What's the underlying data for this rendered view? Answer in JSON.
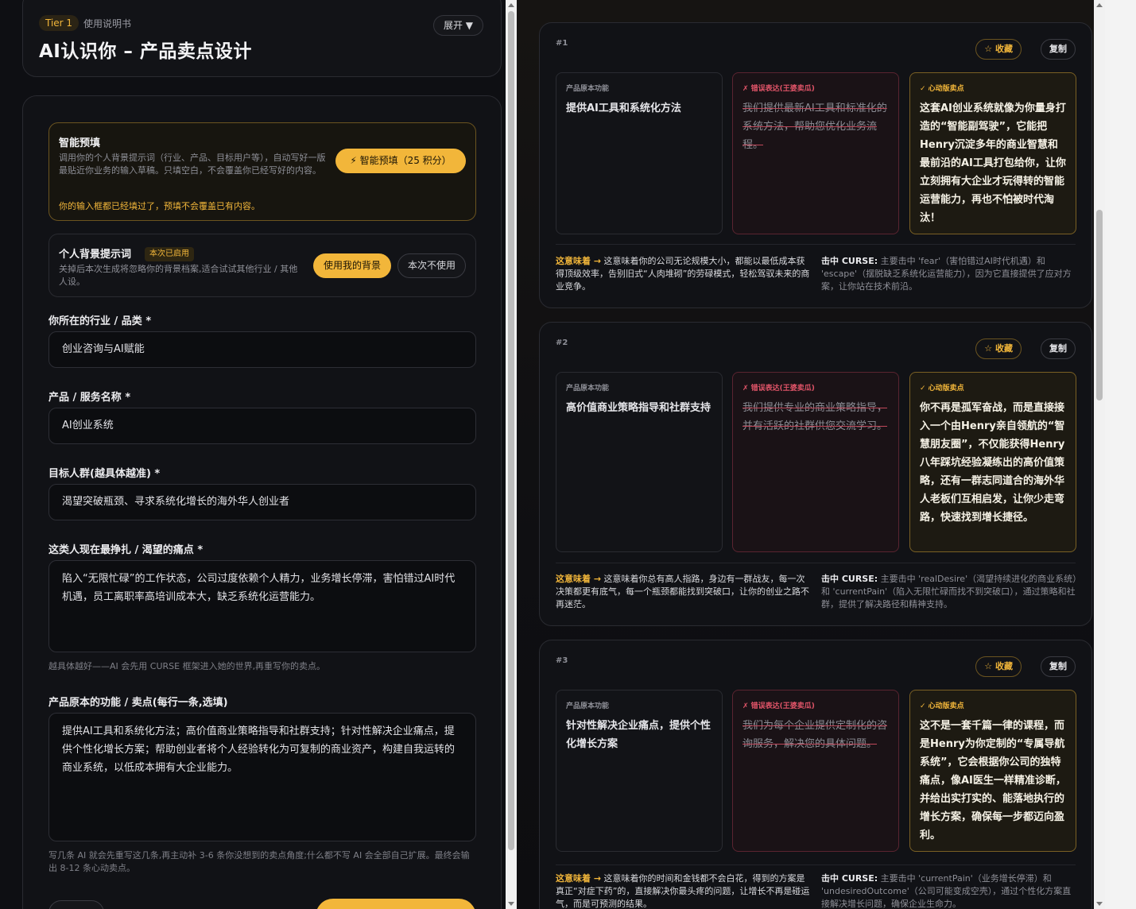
{
  "header": {
    "tier": "Tier 1",
    "subtitle": "使用说明书",
    "title": "AI认识你 – 产品卖点设计",
    "expand": "展开 ▼"
  },
  "smart": {
    "title": "智能预填",
    "desc": "调用你的个人背景提示词（行业、产品、目标用户等），自动写好一版最贴近你业务的输入草稿。只填空白，不会覆盖你已经写好的内容。",
    "warn": "你的输入框都已经填过了，预填不会覆盖已有内容。",
    "button": "⚡ 智能预填（25 积分）"
  },
  "background": {
    "title": "个人背景提示词",
    "badge": "本次已启用",
    "desc": "关掉后本次生成将忽略你的背景档案,适合试试其他行业 / 其他人设。",
    "use_btn": "使用我的背景",
    "skip_btn": "本次不使用"
  },
  "fields": {
    "industry": {
      "label": "你所在的行业 / 品类 *",
      "value": "创业咨询与AI赋能"
    },
    "product": {
      "label": "产品 / 服务名称 *",
      "value": "AI创业系统"
    },
    "audience": {
      "label": "目标人群(越具体越准) *",
      "value": "渴望突破瓶颈、寻求系统化增长的海外华人创业者"
    },
    "pain": {
      "label": "这类人现在最挣扎 / 渴望的痛点 *",
      "value": "陷入“无限忙碌”的工作状态，公司过度依赖个人精力，业务增长停滞，害怕错过AI时代机遇，员工离职率高培训成本大，缺乏系统化运营能力。",
      "hint": "越具体越好——AI 会先用 CURSE 框架进入她的世界,再重写你的卖点。"
    },
    "features": {
      "label": "产品原本的功能 / 卖点(每行一条,选填)",
      "value": "提供AI工具和系统化方法；高价值商业策略指导和社群支持；针对性解决企业痛点，提供个性化增长方案；帮助创业者将个人经验转化为可复制的商业资产，构建自我运转的商业系统，以低成本拥有大企业能力。",
      "hint": "写几条 AI 就会先重写这几条,再主动补 3-6 条你没想到的卖点角度;什么都不写 AI 会全部自己扩展。最终会输出 8-12 条心动卖点。"
    }
  },
  "results": [
    {
      "num": "#1",
      "fav": "☆ 收藏",
      "copy": "复制",
      "orig_tag": "产品原本功能",
      "orig": "提供AI工具和系统化方法",
      "wrong_tag": "✗ 错误表达(王婆卖瓜)",
      "wrong": "我们提供最新AI工具和标准化的系统方法，帮助您优化业务流程。",
      "right_tag": "✓ 心动版卖点",
      "right": "这套AI创业系统就像为你量身打造的“智能副驾驶”，它能把Henry沉淀多年的商业智慧和最前沿的AI工具打包给你，让你立刻拥有大企业才玩得转的智能运营能力，再也不怕被时代淘汰！",
      "meaning_lead": "这意味着 →",
      "meaning": "这意味着你的公司无论规模大小，都能以最低成本获得顶级效率，告别旧式“人肉堆砌”的劳碌模式，轻松驾驭未来的商业竞争。",
      "curse_lead": "击中 CURSE:",
      "curse": "主要击中 'fear'（害怕错过AI时代机遇）和 'escape'（摆脱缺乏系统化运营能力），因为它直接提供了应对方案，让你站在技术前沿。"
    },
    {
      "num": "#2",
      "fav": "☆ 收藏",
      "copy": "复制",
      "orig_tag": "产品原本功能",
      "orig": "高价值商业策略指导和社群支持",
      "wrong_tag": "✗ 错误表达(王婆卖瓜)",
      "wrong": "我们提供专业的商业策略指导，并有活跃的社群供您交流学习。",
      "right_tag": "✓ 心动版卖点",
      "right": "你不再是孤军奋战，而是直接接入一个由Henry亲自领航的“智慧朋友圈”，不仅能获得Henry八年踩坑经验凝练出的高价值策略，还有一群志同道合的海外华人老板们互相启发，让你少走弯路，快速找到增长捷径。",
      "meaning_lead": "这意味着 →",
      "meaning": "这意味着你总有高人指路，身边有一群战友，每一次决策都更有底气，每一个瓶颈都能找到突破口，让你的创业之路不再迷茫。",
      "curse_lead": "击中 CURSE:",
      "curse": "主要击中 'realDesire'（渴望持续进化的商业系统）和 'currentPain'（陷入无限忙碌而找不到突破口），通过策略和社群，提供了解决路径和精神支持。"
    },
    {
      "num": "#3",
      "fav": "☆ 收藏",
      "copy": "复制",
      "orig_tag": "产品原本功能",
      "orig": "针对性解决企业痛点，提供个性化增长方案",
      "wrong_tag": "✗ 错误表达(王婆卖瓜)",
      "wrong": "我们为每个企业提供定制化的咨询服务，解决您的具体问题。",
      "right_tag": "✓ 心动版卖点",
      "right": "这不是一套千篇一律的课程，而是Henry为你定制的“专属导航系统”，它会根据你公司的独特痛点，像AI医生一样精准诊断，并给出实打实的、能落地执行的增长方案，确保每一步都迈向盈利。",
      "meaning_lead": "这意味着 →",
      "meaning": "这意味着你的时间和金钱都不会白花，得到的方案是真正“对症下药”的，直接解决你最头疼的问题，让增长不再是碰运气，而是可预测的结果。",
      "curse_lead": "击中 CURSE:",
      "curse": "主要击中 'currentPain'（业务增长停滞）和 'undesiredOutcome'（公司可能变成空壳），通过个性化方案直接解决增长问题，确保企业生命力。"
    }
  ]
}
